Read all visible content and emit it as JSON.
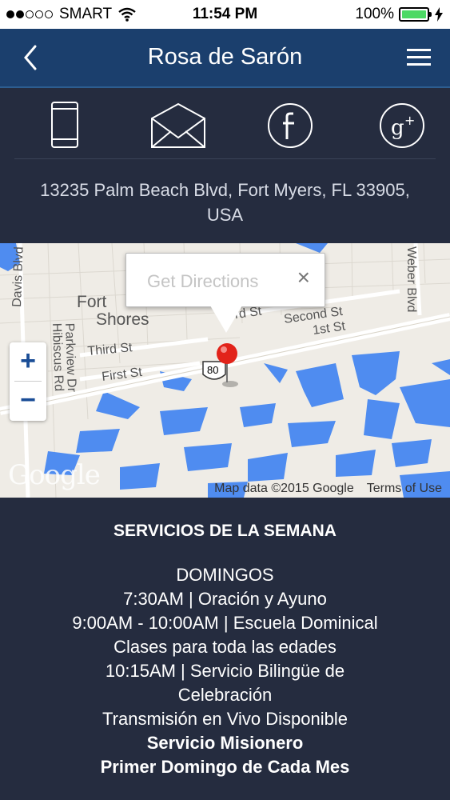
{
  "status_bar": {
    "carrier": "SMART",
    "time": "11:54 PM",
    "battery": "100%",
    "signal_dots": [
      1,
      1,
      0,
      0,
      0
    ]
  },
  "nav": {
    "title": "Rosa de Sarón",
    "back_icon": "chevron-left-icon",
    "menu_icon": "hamburger-menu-icon"
  },
  "contact_icons": [
    "phone-icon",
    "email-icon",
    "facebook-icon",
    "google-plus-icon"
  ],
  "address": "13235 Palm Beach Blvd, Fort Myers, FL 33905, USA",
  "map": {
    "popup_label": "Get Directions",
    "popup_close": "×",
    "zoom_in": "+",
    "zoom_out": "−",
    "logo": "Google",
    "attribution": "Map data ©2015 Google",
    "terms": "Terms of Use",
    "route_badge": "80",
    "street_labels": [
      "Davis Blvd",
      "Hibiscus Rd",
      "Parkview Dr",
      "Fort",
      "Shores",
      "Third St",
      "First St",
      "hird St",
      "Second St",
      "1st St",
      "Weber Blvd"
    ]
  },
  "services": {
    "heading": "SERVICIOS DE LA SEMANA",
    "lines": [
      "DOMINGOS",
      "7:30AM | Oración y Ayuno",
      "9:00AM - 10:00AM | Escuela Dominical",
      "Clases para toda las edades",
      "10:15AM | Servicio Bilingüe de",
      "Celebración",
      "Transmisión en Vivo Disponible"
    ],
    "bold_lines": [
      "Servicio Misionero",
      "Primer Domingo de Cada Mes"
    ]
  },
  "colors": {
    "nav_bg": "#1b3f6d",
    "page_bg": "#252c3f",
    "battery_green": "#4cd964",
    "water_blue": "#4f8cf0",
    "pin_red": "#e2231a"
  }
}
